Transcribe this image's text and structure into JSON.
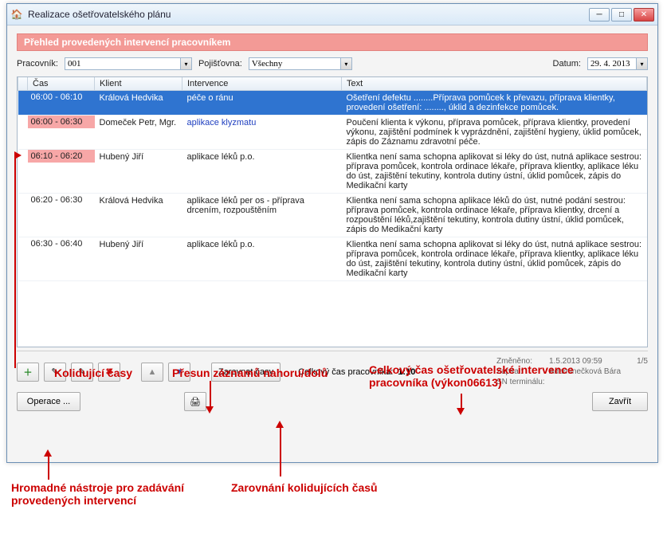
{
  "window": {
    "title": "Realizace ošetřovatelského plánu"
  },
  "section_title": "Přehled provedených intervencí pracovníkem",
  "filters": {
    "worker_label": "Pracovník:",
    "worker_value": "001",
    "insurer_label": "Pojišťovna:",
    "insurer_value": "Všechny",
    "date_label": "Datum:",
    "date_value": "29. 4. 2013"
  },
  "columns": {
    "time": "Čas",
    "client": "Klient",
    "intervention": "Intervence",
    "text": "Text"
  },
  "rows": [
    {
      "time": "06:00 - 06:10",
      "client": "Králová Hedvika",
      "intervention": "péče o ránu",
      "text": "Ošetření defektu ........Příprava pomůcek k převazu, příprava klientky, provedení ošetření: ........, úklid a dezinfekce pomůcek.",
      "selected": true,
      "conflict": false,
      "link": false
    },
    {
      "time": "06:00 - 06:30",
      "client": "Domeček Petr, Mgr.",
      "intervention": "aplikace klyzmatu",
      "text": "Poučení klienta k výkonu, příprava pomůcek, příprava klientky, provedení výkonu, zajištění podmínek k vyprázdnění, zajištění hygieny, úklid pomůcek, zápis do Záznamu zdravotní péče.",
      "selected": false,
      "conflict": true,
      "link": true
    },
    {
      "time": "06:10 - 06:20",
      "client": "Hubený Jiří",
      "intervention": "aplikace léků p.o.",
      "text": "Klientka není sama schopna aplikovat si léky do úst, nutná aplikace sestrou: příprava pomůcek, kontrola ordinace lékaře, příprava klientky, aplikace léku do úst, zajištění tekutiny, kontrola dutiny ústní, úklid pomůcek, zápis do Medikační karty",
      "selected": false,
      "conflict": true,
      "link": false
    },
    {
      "time": "06:20 - 06:30",
      "client": "Králová Hedvika",
      "intervention": "aplikace léků per os - příprava drcením, rozpouštěním",
      "text": "Klientka není sama schopna aplikace léků do úst,  nutné podání sestrou: příprava pomůcek, kontrola ordinace lékaře, příprava klientky, drcení a rozpouštění léků,zajištění tekutiny, kontrola dutiny ústní,  úklid pomůcek, zápis do Medikační karty",
      "selected": false,
      "conflict": false,
      "link": false
    },
    {
      "time": "06:30 - 06:40",
      "client": "Hubený Jiří",
      "intervention": "aplikace léků p.o.",
      "text": "Klientka není sama schopna aplikovat si léky do úst, nutná aplikace sestrou: příprava pomůcek, kontrola ordinace lékaře, příprava klientky, aplikace léku do úst, zajištění tekutiny, kontrola dutiny ústní, úklid pomůcek, zápis do Medikační karty",
      "selected": false,
      "conflict": false,
      "link": false
    }
  ],
  "toolbar": {
    "align_times": "Zarovnat časy",
    "total_label": "Celkový čas pracovníka:",
    "total_value": "1:10"
  },
  "meta": {
    "changed_label": "Změněno:",
    "changed_value": "1.5.2013 09:59",
    "entered_label": "Zapsal:",
    "entered_value": "Adamínečková Bára",
    "terminal_label": "SN terminálu:",
    "terminal_value": "",
    "page": "1/5"
  },
  "bottom": {
    "operations": "Operace ...",
    "close": "Zavřít"
  },
  "annotations": {
    "conflict": "Kolidující časy",
    "move": "Přesun záznamů nahoru/dolů",
    "total": "Celkový čas ošetřovatelské intervence pracovníka (výkon06613)",
    "align": "Zarovnání kolidujících časů",
    "ops": "Hromadné nástroje pro zadávání provedených intervencí"
  }
}
